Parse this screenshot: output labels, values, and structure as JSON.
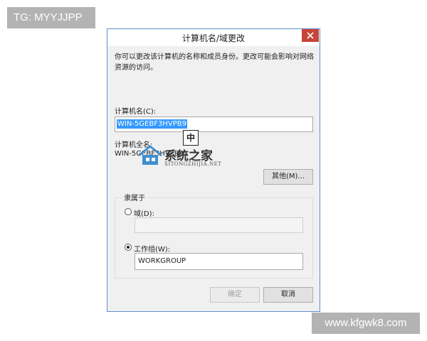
{
  "tag_label": "TG: MYYJJPP",
  "site_label": "www.kfgwk8.com",
  "dialog": {
    "title": "计算机名/域更改",
    "description": "你可以更改该计算机的名称和成员身份。更改可能会影响对网络资源的访问。",
    "computer_name_label": "计算机名(C):",
    "computer_name_value": "WIN-5GEBF3HVPB9",
    "full_name_label": "计算机全名:",
    "full_name_value": "WIN-5GEBF3HVPB9",
    "more_button": "其他(M)...",
    "member_of_label": "隶属于",
    "domain_radio_label": "域(D):",
    "domain_value": "",
    "workgroup_radio_label": "工作组(W):",
    "workgroup_value": "WORKGROUP",
    "ok_button": "确定",
    "cancel_button": "取消",
    "selected_membership": "workgroup"
  },
  "ime_indicator": "中",
  "watermark": {
    "main": "系统之家",
    "sub": "XITONGZHIJIA.NET"
  },
  "colors": {
    "title_border": "#5e8fc8",
    "close_red": "#c7453a",
    "selection_blue": "#3399ff"
  }
}
